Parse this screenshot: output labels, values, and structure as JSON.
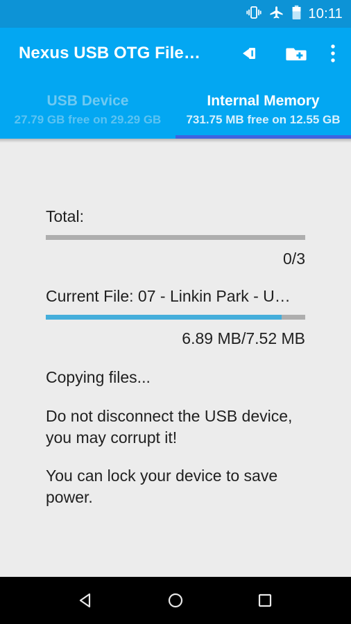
{
  "status_bar": {
    "icons": [
      "vibrate-icon",
      "airplane-mode-icon",
      "battery-icon"
    ],
    "time": "10:11",
    "background": "#0d93d6"
  },
  "app_bar": {
    "title": "Nexus USB OTG File…",
    "background": "#03a7f2",
    "actions": [
      {
        "name": "paste-icon",
        "label": "Paste"
      },
      {
        "name": "new-folder-icon",
        "label": "New Folder"
      },
      {
        "name": "overflow-menu-icon",
        "label": "More options"
      }
    ]
  },
  "tabs": {
    "indicator_color": "#3f63e0",
    "items": [
      {
        "title": "USB Device",
        "subtitle": "27.79 GB free on 29.29 GB",
        "active": false
      },
      {
        "title": "Internal Memory",
        "subtitle": "731.75 MB free on 12.55 GB",
        "active": true
      }
    ]
  },
  "transfer": {
    "total_label": "Total:",
    "total_progress_percent": 0,
    "total_count": "0/3",
    "current_file_label": "Current File: 07 - Linkin Park - U…",
    "current_progress_percent": 91,
    "current_size": "6.89 MB/7.52 MB",
    "progress_fill_color": "#45aedb",
    "progress_track_color": "#aeaeae",
    "status_message": "Copying files...",
    "warning_message": "Do not disconnect the USB device, you may corrupt it!",
    "tip_message": "You can lock your device to save power."
  },
  "nav_bar": {
    "background": "#000000",
    "buttons": [
      {
        "name": "back-button",
        "label": "Back"
      },
      {
        "name": "home-button",
        "label": "Home"
      },
      {
        "name": "recents-button",
        "label": "Recents"
      }
    ]
  }
}
